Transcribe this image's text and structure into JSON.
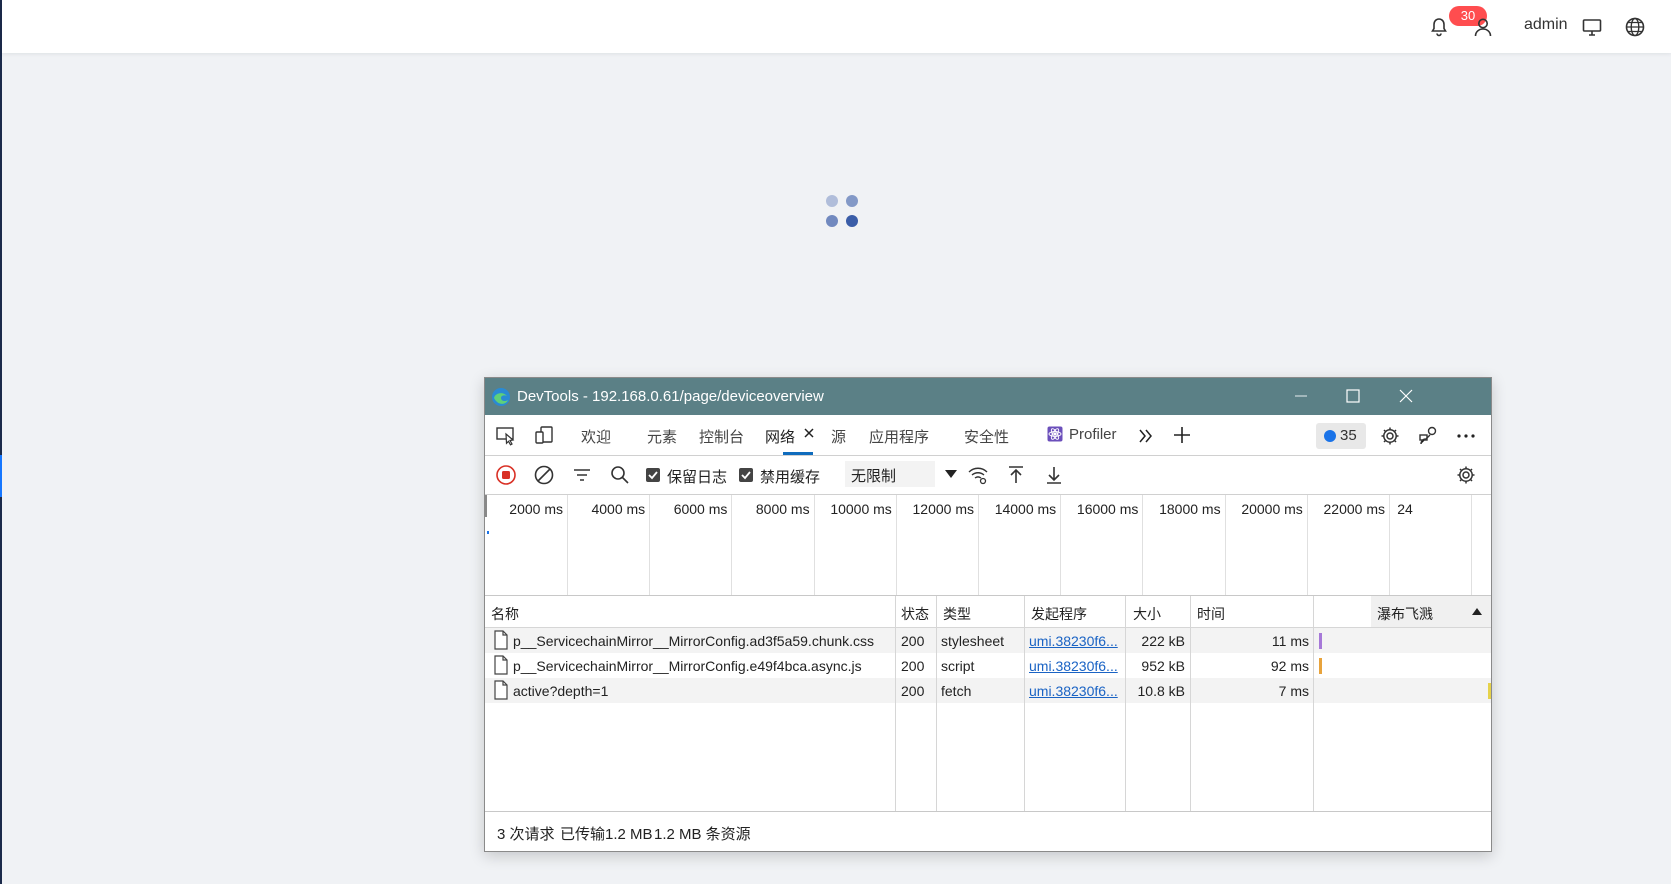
{
  "app": {
    "notification_count": "30",
    "username": "admin"
  },
  "devtools": {
    "window_title": "DevTools - 192.168.0.61/page/deviceoverview",
    "tabs": [
      {
        "label": "欢迎"
      },
      {
        "label": "元素"
      },
      {
        "label": "控制台"
      },
      {
        "label": "网络",
        "active": true
      },
      {
        "label": "源"
      },
      {
        "label": "应用程序"
      },
      {
        "label": "安全性"
      },
      {
        "label": "Profiler"
      }
    ],
    "issues_count": "35",
    "toolbar": {
      "preserve_log_label": "保留日志",
      "preserve_log_checked": true,
      "disable_cache_label": "禁用缓存",
      "disable_cache_checked": true,
      "throttling_value": "无限制"
    },
    "overview_ticks": [
      "2000 ms",
      "4000 ms",
      "6000 ms",
      "8000 ms",
      "10000 ms",
      "12000 ms",
      "14000 ms",
      "16000 ms",
      "18000 ms",
      "20000 ms",
      "22000 ms",
      "24"
    ],
    "columns": {
      "name": "名称",
      "status": "状态",
      "type": "类型",
      "initiator": "发起程序",
      "size": "大小",
      "time": "时间",
      "waterfall": "瀑布飞溅"
    },
    "rows": [
      {
        "name": "p__ServicechainMirror__MirrorConfig.ad3f5a59.chunk.css",
        "status": "200",
        "type": "stylesheet",
        "initiator": "umi.38230f6...",
        "size": "222 kB",
        "time": "11 ms"
      },
      {
        "name": "p__ServicechainMirror__MirrorConfig.e49f4bca.async.js",
        "status": "200",
        "type": "script",
        "initiator": "umi.38230f6...",
        "size": "952 kB",
        "time": "92 ms"
      },
      {
        "name": "active?depth=1",
        "status": "200",
        "type": "fetch",
        "initiator": "umi.38230f6...",
        "size": "10.8 kB",
        "time": "7 ms"
      }
    ],
    "status_bar": {
      "requests": "3 次请求",
      "transferred": "已传输1.2 MB",
      "resources": "1.2 MB 条资源"
    },
    "colors": {
      "title_bar": "#5b8086",
      "active_tab_underline": "#0f6cbd",
      "css_bar": "#a678d8",
      "js_bar": "#e8a33c",
      "fetch_bar": "#e6d24a"
    }
  }
}
